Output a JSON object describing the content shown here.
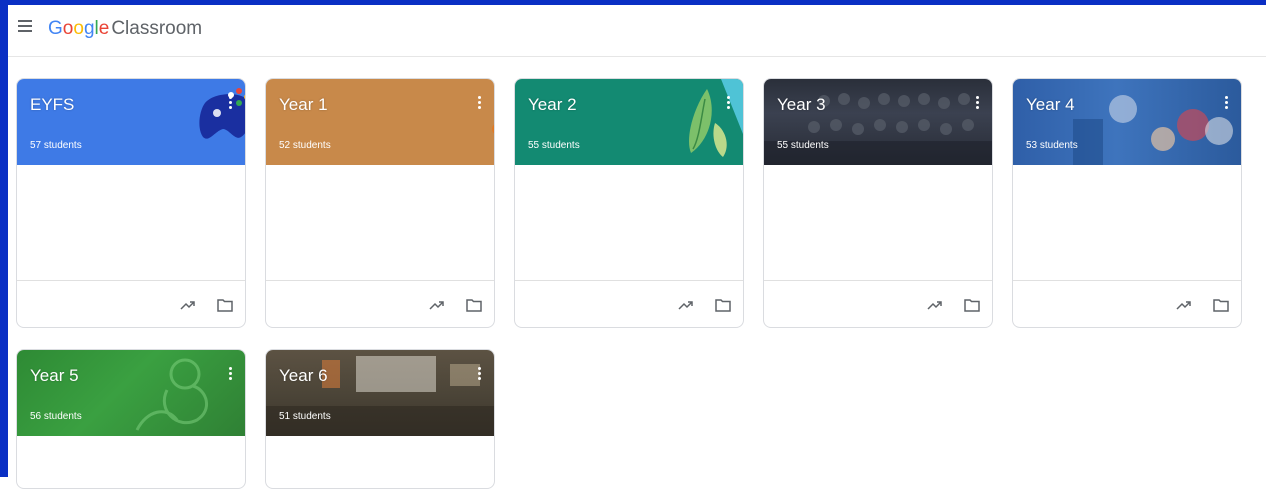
{
  "app": {
    "brand": [
      "G",
      "o",
      "o",
      "g",
      "l",
      "e"
    ],
    "product": "Classroom"
  },
  "accent_color": "#0a2fc4",
  "classes": [
    {
      "title": "EYFS",
      "students": "57 students",
      "color": "#3e7ae6",
      "illustration": "game-controller"
    },
    {
      "title": "Year 1",
      "students": "52 students",
      "color": "#c8894a",
      "illustration": "none"
    },
    {
      "title": "Year 2",
      "students": "55 students",
      "color": "#138a72",
      "illustration": "pea-pod"
    },
    {
      "title": "Year 3",
      "students": "55 students",
      "color": "#2f3440",
      "illustration": "class-photo"
    },
    {
      "title": "Year 4",
      "students": "53 students",
      "color": "#3e74bd",
      "illustration": "class-photo"
    },
    {
      "title": "Year 5",
      "students": "56 students",
      "color": "#3aa041",
      "illustration": "monkey-photo"
    },
    {
      "title": "Year 6",
      "students": "51 students",
      "color": "#4c4538",
      "illustration": "classroom-photo"
    }
  ],
  "icons": {
    "menu": "menu-icon",
    "more": "more-vert-icon",
    "gradebook": "trending-up-icon",
    "drive": "folder-icon"
  }
}
